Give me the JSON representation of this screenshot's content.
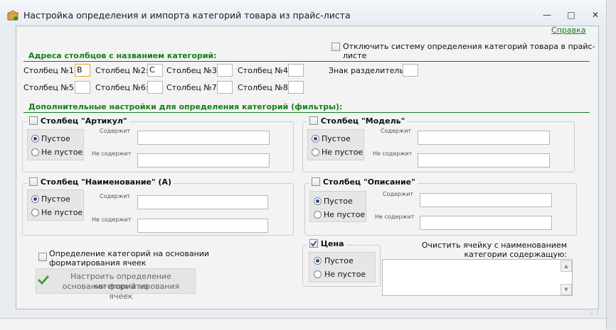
{
  "window": {
    "title": "Настройка определения и импорта категорий товара из прайс-листа",
    "help_link": "Справка"
  },
  "disable_system": {
    "label": "Отключить систему определения категорий товара в прайс-листе",
    "checked": false
  },
  "columns_section": {
    "title": "Адреса столбцов с названием категорий:",
    "columns": [
      {
        "label": "Столбец №1:",
        "value": "В"
      },
      {
        "label": "Столбец №2:",
        "value": "С"
      },
      {
        "label": "Столбец №3:",
        "value": ""
      },
      {
        "label": "Столбец №4:",
        "value": ""
      },
      {
        "label": "Столбец №5:",
        "value": ""
      },
      {
        "label": "Столбец №6:",
        "value": ""
      },
      {
        "label": "Столбец №7:",
        "value": ""
      },
      {
        "label": "Столбец №8:",
        "value": ""
      }
    ],
    "separator": {
      "label": "Знак разделитель:",
      "value": ""
    }
  },
  "filters_section": {
    "title": "Дополнительные настройки для определения категорий (фильтры):",
    "option_empty": "Пустое",
    "option_not_empty": "Не пустое",
    "contains_label": "Содержит",
    "not_contains_label": "Не содержит",
    "groups": [
      {
        "title": "Столбец \"Артикул\"",
        "checked": false,
        "selected": "empty"
      },
      {
        "title": "Столбец \"Модель\"",
        "checked": false,
        "selected": "empty"
      },
      {
        "title": "Столбец \"Наименование\" (А)",
        "checked": false,
        "selected": "empty"
      },
      {
        "title": "Столбец \"Описание\"",
        "checked": false,
        "selected": "empty"
      },
      {
        "title": "Цена",
        "checked": true,
        "selected": "empty"
      }
    ]
  },
  "formatting": {
    "checkbox_label_1": "Определение категорий на основании",
    "checkbox_label_2": "форматирования ячеек",
    "button_line_1": "Настроить определение категорий на",
    "button_line_2": "основании форматирования ячеек"
  },
  "clear_cell": {
    "label_line_1": "Очистить ячейку с наименованием",
    "label_line_2": "категории содержащую:",
    "value": ""
  },
  "colors": {
    "accent_green": "#148018",
    "link_green": "#157a1e",
    "radio_dot": "#2a4d8c"
  }
}
